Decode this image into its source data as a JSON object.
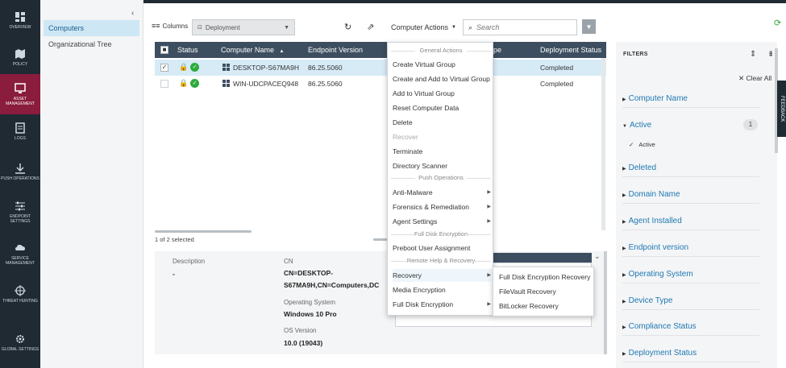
{
  "nav": {
    "items": [
      {
        "label": "OVERVIEW",
        "icon": "dashboard-icon"
      },
      {
        "label": "POLICY",
        "icon": "map-icon"
      },
      {
        "label": "ASSET MANAGEMENT",
        "icon": "monitor-icon"
      },
      {
        "label": "LOGS",
        "icon": "document-icon"
      },
      {
        "label": "PUSH OPERATIONS",
        "icon": "download-icon"
      },
      {
        "label": "ENDPOINT SETTINGS",
        "icon": "sliders-icon"
      },
      {
        "label": "SERVICE MANAGEMENT",
        "icon": "cloud-gear-icon"
      },
      {
        "label": "THREAT HUNTING",
        "icon": "crosshair-icon"
      },
      {
        "label": "GLOBAL SETTINGS",
        "icon": "gear-icon"
      }
    ]
  },
  "subnav": {
    "items": [
      {
        "label": "Computers"
      },
      {
        "label": "Organizational Tree"
      }
    ]
  },
  "toolbar": {
    "columns_label": "Columns",
    "deployment_value": "Deployment",
    "computer_actions_label": "Computer Actions",
    "search_placeholder": "Search"
  },
  "table": {
    "headers": {
      "status": "Status",
      "computer_name": "Computer Name",
      "endpoint_version": "Endpoint Version",
      "type": "pe",
      "deployment_status": "Deployment Status"
    },
    "rows": [
      {
        "computer_name": "DESKTOP-S67MA9H",
        "endpoint_version": "86.25.5060",
        "deployment_status": "Completed"
      },
      {
        "computer_name": "WIN-UDCPACEQ948",
        "endpoint_version": "86.25.5060",
        "deployment_status": "Completed"
      }
    ],
    "selection_text": "1 of 2 selected"
  },
  "details": {
    "description_label": "Description",
    "description_value": "-",
    "cn_label": "CN",
    "cn_value_line1": "CN=DESKTOP-",
    "cn_value_line2": "S67MA9H,CN=Computers,DC",
    "os_label": "Operating System",
    "os_value": "Windows 10 Pro",
    "os_version_label": "OS Version",
    "os_version_value": "10.0 (19043)"
  },
  "menu": {
    "general_header": "General Actions",
    "create_virtual_group": "Create Virtual Group",
    "create_add_virtual_group": "Create and Add to Virtual Group",
    "add_virtual_group": "Add to Virtual Group",
    "reset_computer_data": "Reset Computer Data",
    "delete": "Delete",
    "recover": "Recover",
    "terminate": "Terminate",
    "directory_scanner": "Directory Scanner",
    "push_header": "Push Operations",
    "anti_malware": "Anti-Malware",
    "forensics": "Forensics & Remediation",
    "agent_settings": "Agent Settings",
    "fde_header": "Full Disk Encryption",
    "preboot": "Preboot User Assignment",
    "remote_header": "Remote Help & Recovery",
    "recovery": "Recovery",
    "media_encryption": "Media Encryption",
    "full_disk_encryption": "Full Disk Encryption"
  },
  "submenu": {
    "fde_recovery": "Full Disk Encryption Recovery",
    "filevault_recovery": "FileVault Recovery",
    "bitlocker_recovery": "BitLocker Recovery"
  },
  "filters": {
    "title": "FILTERS",
    "clear_all": "Clear All",
    "items": [
      {
        "label": "Computer Name"
      },
      {
        "label": "Active"
      },
      {
        "label": "Deleted"
      },
      {
        "label": "Domain Name"
      },
      {
        "label": "Agent Installed"
      },
      {
        "label": "Endpoint version"
      },
      {
        "label": "Operating System"
      },
      {
        "label": "Device Type"
      },
      {
        "label": "Compliance Status"
      },
      {
        "label": "Deployment Status"
      }
    ],
    "active_count": "1",
    "active_option": "Active"
  },
  "feedback_label": "FEEDBACK",
  "colors": {
    "nav_bg": "#1f2a33",
    "nav_active": "#8a1c3d",
    "table_header": "#3d4e60",
    "row_selected": "#d7ebf7",
    "link": "#1f78b4",
    "ok_green": "#2eaa3f"
  }
}
